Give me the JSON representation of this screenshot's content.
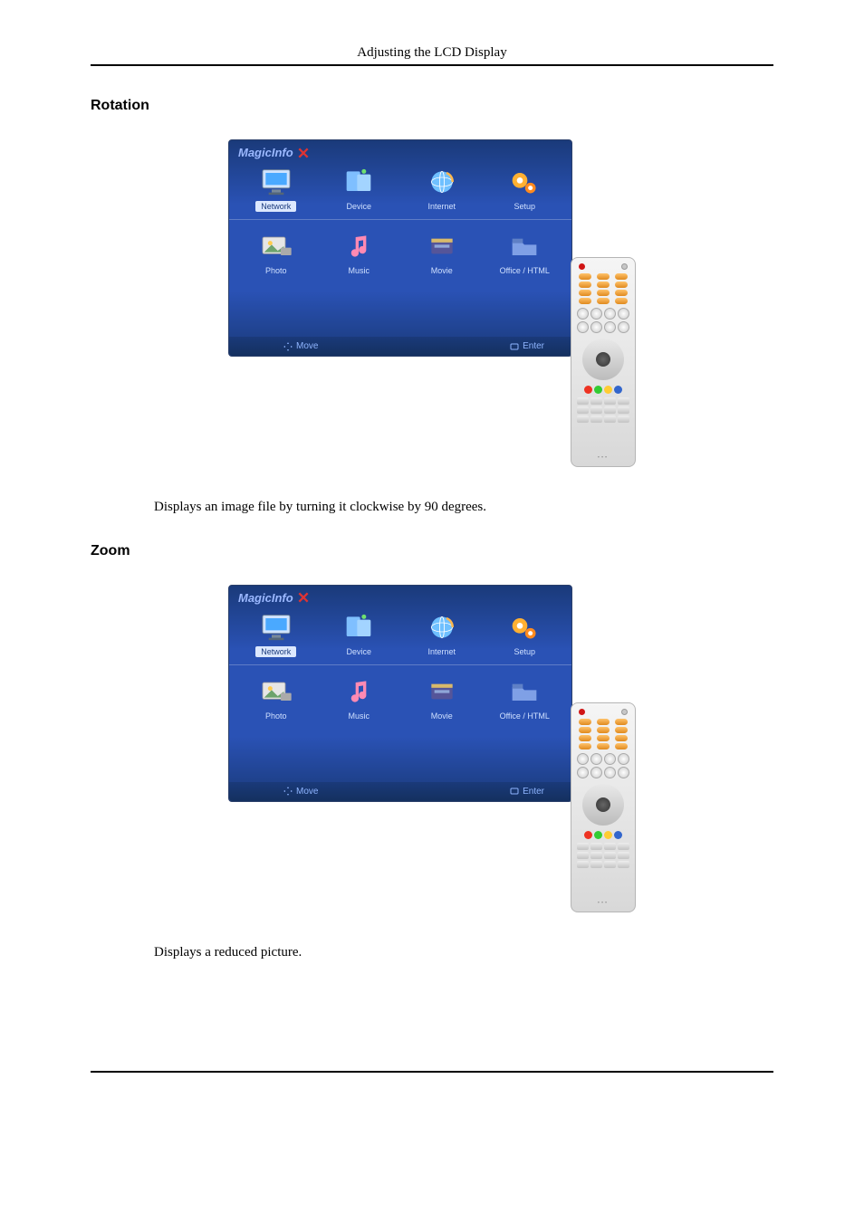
{
  "header": {
    "title": "Adjusting the LCD Display"
  },
  "sections": {
    "rotation": {
      "heading": "Rotation",
      "body": "Displays an image file by turning it clockwise by 90 degrees."
    },
    "zoom": {
      "heading": "Zoom",
      "body": "Displays a reduced picture."
    }
  },
  "ui": {
    "logo": "MagicInfo",
    "row1": [
      {
        "label": "Network",
        "icon": "monitor",
        "selected": true
      },
      {
        "label": "Device",
        "icon": "device",
        "selected": false
      },
      {
        "label": "Internet",
        "icon": "globe",
        "selected": false
      },
      {
        "label": "Setup",
        "icon": "gear",
        "selected": false
      }
    ],
    "row2": [
      {
        "label": "Photo",
        "icon": "photo"
      },
      {
        "label": "Music",
        "icon": "music"
      },
      {
        "label": "Movie",
        "icon": "movie"
      },
      {
        "label": "Office / HTML",
        "icon": "folder"
      }
    ],
    "footer": {
      "move": "Move",
      "enter": "Enter"
    }
  }
}
